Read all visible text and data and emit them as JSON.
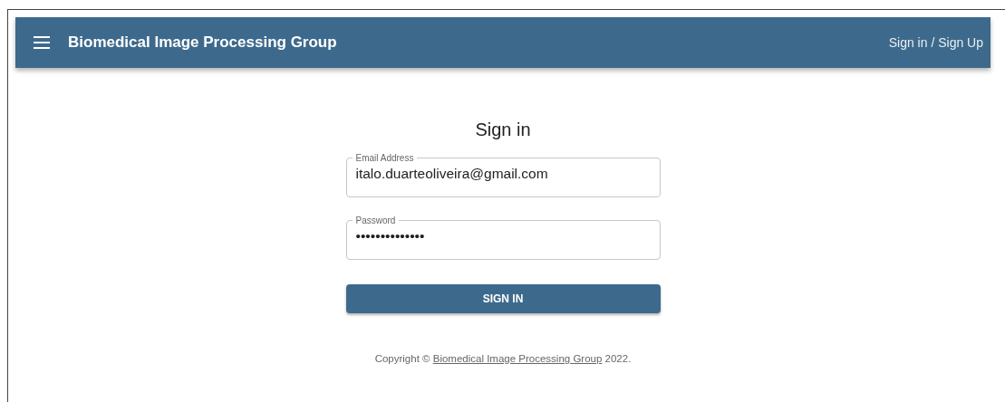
{
  "app_bar": {
    "title": "Biomedical Image Processing Group",
    "action": "Sign in / Sign Up"
  },
  "form": {
    "title": "Sign in",
    "fields": [
      {
        "label": "Email Address",
        "value": "italo.duarteoliveira@gmail.com"
      },
      {
        "label": "Password",
        "value": "••••••••••••••"
      }
    ],
    "button": "SIGN IN"
  },
  "footer": {
    "prefix": "Copyright ©",
    "link": "Biomedical Image Processing Group",
    "suffix": "2022."
  }
}
